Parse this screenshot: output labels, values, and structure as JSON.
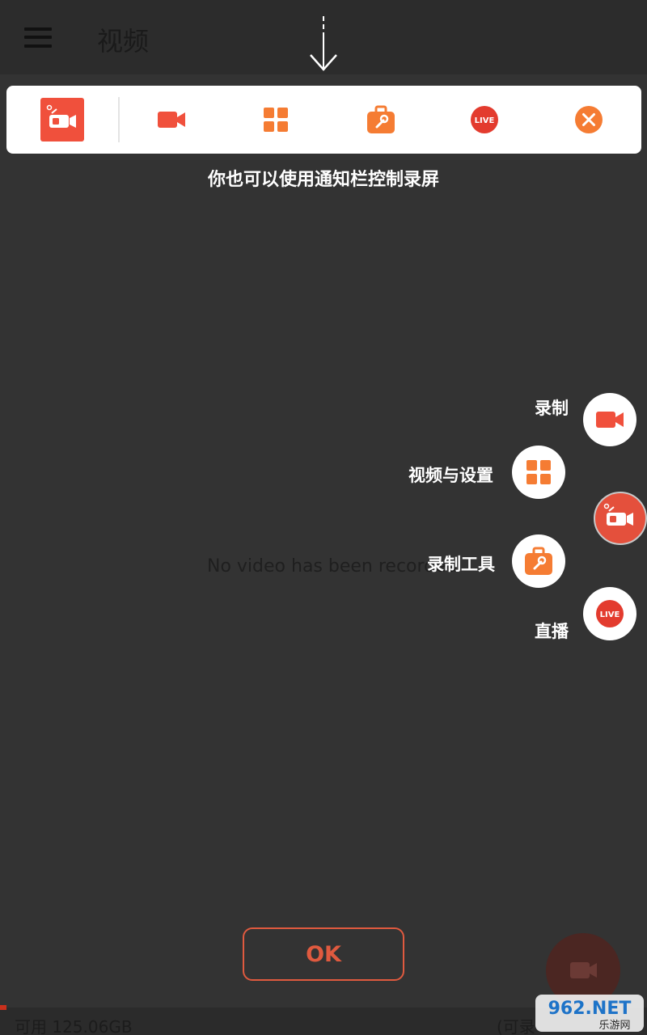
{
  "app_bar": {
    "title": "视频",
    "menu_icon": "hamburger-menu-icon"
  },
  "notification_bar": {
    "icons": [
      "app-logo-icon",
      "record-icon",
      "grid-icon",
      "toolbox-icon",
      "live-icon",
      "close-icon"
    ],
    "hint": "你也可以使用通知栏控制录屏"
  },
  "empty_state": {
    "text": "No video has been recorded"
  },
  "floating_menu": {
    "items": [
      {
        "label": "录制",
        "icon": "record-icon"
      },
      {
        "label": "视频与设置",
        "icon": "grid-icon"
      },
      {
        "label": "录制工具",
        "icon": "toolbox-icon"
      },
      {
        "label": "直播",
        "icon": "live-icon",
        "badge": "LIVE"
      }
    ]
  },
  "ok_button": {
    "label": "OK"
  },
  "storage": {
    "available": "可用 125.06GB",
    "remaining": "(可录"
  },
  "watermark": {
    "text": "962.NET",
    "subtext": "乐游网"
  },
  "colors": {
    "accent": "#f0503c",
    "orange": "#f57c33",
    "background": "#333333",
    "appbar": "#2c2c2c"
  }
}
